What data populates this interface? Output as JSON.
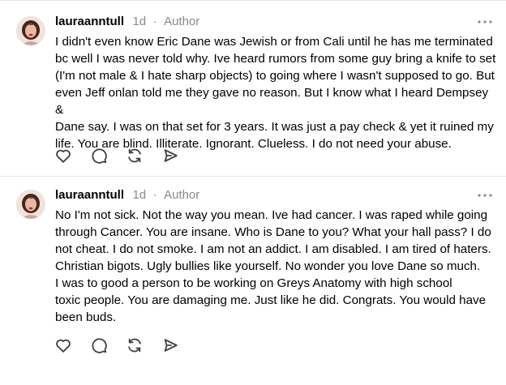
{
  "posts": [
    {
      "username": "lauraanntull",
      "time": "1d",
      "role": "Author",
      "lines": [
        "I didn't even know Eric Dane was Jewish or from Cali until he has me terminated",
        "bc well I was never told why. Ive heard rumors from some guy bring a knife to set",
        "(I'm not male & I hate sharp objects) to going where I wasn't supposed to go. But",
        "even Jeff onlan told me they gave no reason. But I know what I heard Dempsey &",
        "Dane say. I was on that set for 3 years. It was just a pay check & yet it ruined my",
        "life. You are blind. Illiterate. Ignorant. Clueless. I do not need your abuse."
      ]
    },
    {
      "username": "lauraanntull",
      "time": "1d",
      "role": "Author",
      "lines": [
        "No I'm not sick. Not the way you mean. Ive had cancer. I was raped while going",
        "through Cancer. You are insane. Who is Dane to you? What your hall pass? I do",
        "not cheat. I do not smoke. I am not an addict. I am disabled. I am tired of haters.",
        "Christian bigots. Ugly bullies like yourself. No wonder you love Dane so much.",
        "I was to good a person to be working on Greys Anatomy with high school",
        "toxic people. You are damaging me. Just like he did. Congrats. You would have",
        "been buds."
      ]
    }
  ],
  "icons": {
    "like": "heart-icon",
    "reply": "reply-bubble-icon",
    "repost": "repost-icon",
    "share": "share-send-icon",
    "more": "more-options-icon"
  },
  "colors": {
    "text": "#000000",
    "meta": "#8a8a8a",
    "icon": "#424242",
    "divider": "#e6e6e6"
  }
}
